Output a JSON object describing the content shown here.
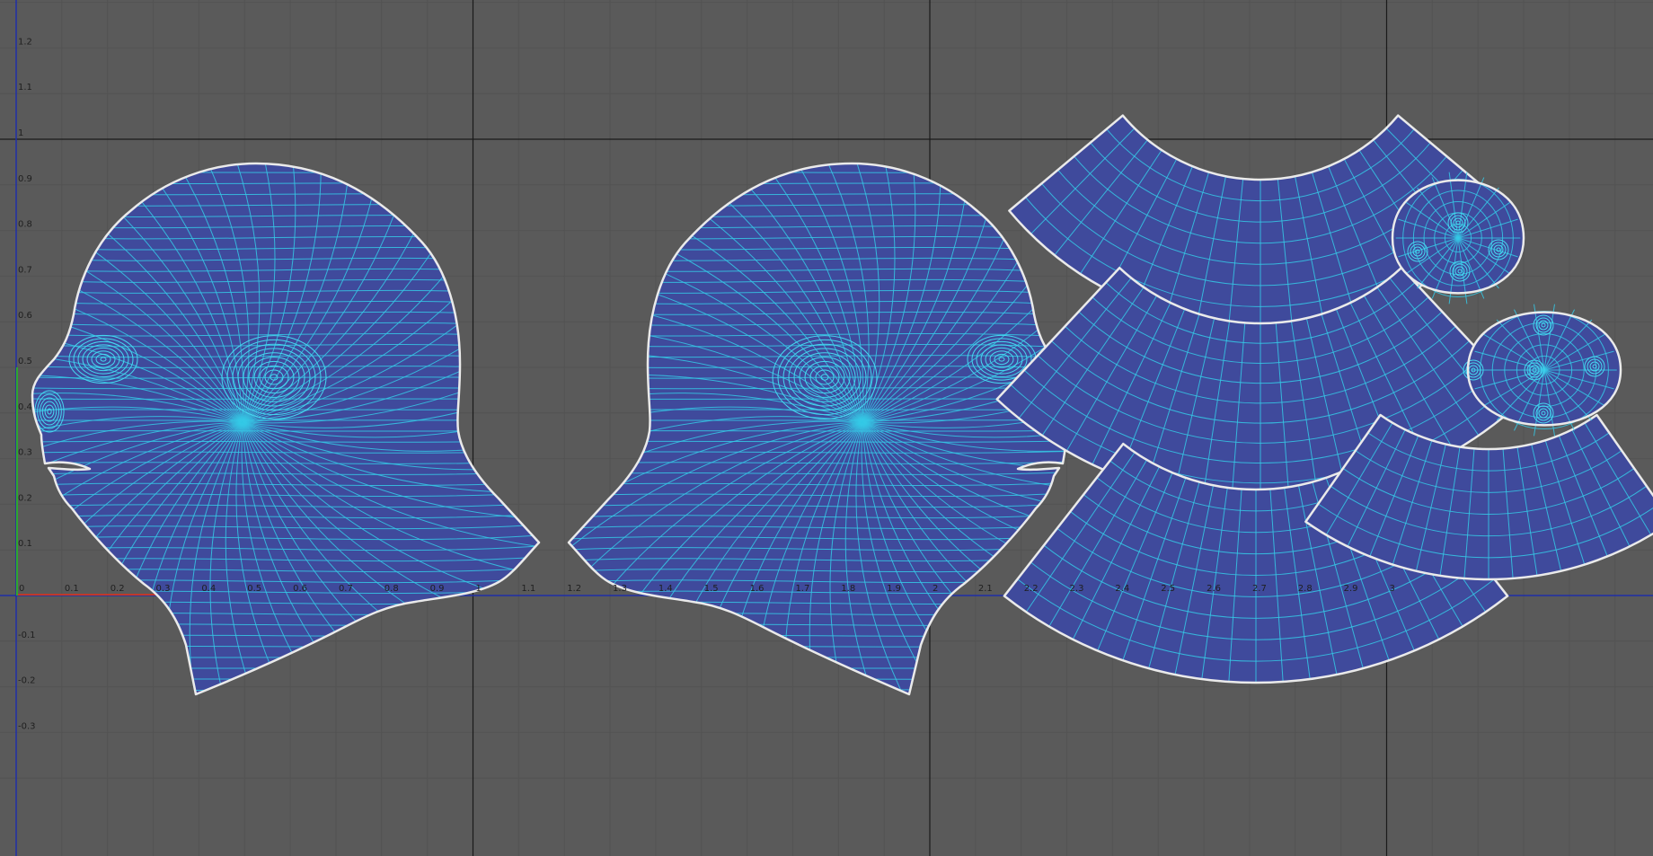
{
  "viewport": {
    "name": "uv-texture-editor",
    "background": "#5a5a5a",
    "grid_minor_color": "#535353",
    "grid_major_color": "#1a1a1a",
    "u_axis_color": "#1f2ea8",
    "v_axis_color": "#1f2ea8",
    "u_unit_indicator_color": "#c0392b",
    "v_unit_indicator_color": "#2fa62f",
    "shell_fill": "#3f4a9c",
    "shell_outline": "#eaeaea",
    "wire_color": "#35c9e6"
  },
  "u_ticks": [
    "0",
    "0.1",
    "0.2",
    "0.3",
    "0.4",
    "0.5",
    "0.6",
    "0.7",
    "0.8",
    "0.9",
    "1",
    "1.1",
    "1.2",
    "1.3",
    "1.4",
    "1.5",
    "1.6",
    "1.7",
    "1.8",
    "1.9",
    "2",
    "2.1",
    "2.2",
    "2.3",
    "2.4",
    "2.5",
    "2.6",
    "2.7",
    "2.8",
    "2.9",
    "3"
  ],
  "v_ticks": [
    "1.2",
    "1.1",
    "1",
    "0.9",
    "0.8",
    "0.7",
    "0.6",
    "0.5",
    "0.4",
    "0.3",
    "0.2",
    "0.1",
    "0",
    "-0.1",
    "-0.2",
    "-0.3"
  ],
  "u_tick_values": [
    0,
    0.1,
    0.2,
    0.3,
    0.4,
    0.5,
    0.6,
    0.7,
    0.8,
    0.9,
    1,
    1.1,
    1.2,
    1.3,
    1.4,
    1.5,
    1.6,
    1.7,
    1.8,
    1.9,
    2,
    2.1,
    2.2,
    2.3,
    2.4,
    2.5,
    2.6,
    2.7,
    2.8,
    2.9,
    3
  ],
  "v_tick_values": [
    1.2,
    1.1,
    1,
    0.9,
    0.8,
    0.7,
    0.6,
    0.5,
    0.4,
    0.3,
    0.2,
    0.1,
    0,
    -0.1,
    -0.2,
    -0.3
  ],
  "uv_shells": [
    "head-left-side",
    "head-right-side",
    "scalp-strip-top",
    "scalp-strip-2",
    "scalp-strip-3",
    "scalp-strip-4",
    "ear-patch-top",
    "ear-patch-bottom"
  ]
}
